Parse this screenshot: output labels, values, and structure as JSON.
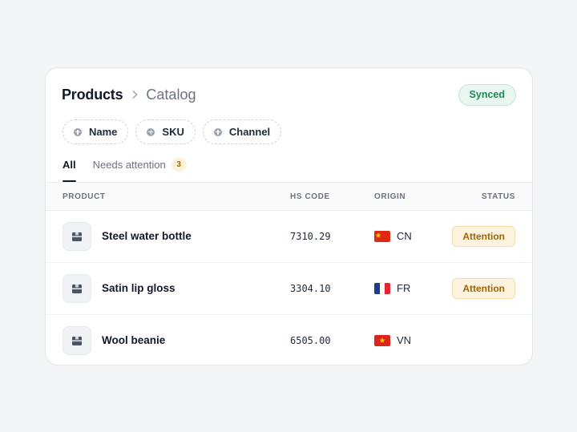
{
  "header": {
    "breadcrumb_main": "Products",
    "breadcrumb_sub": "Catalog",
    "sync_status": "Synced"
  },
  "filters": [
    {
      "label": "Name",
      "icon": "plus-circle-icon"
    },
    {
      "label": "SKU",
      "icon": "plus-circle-icon"
    },
    {
      "label": "Channel",
      "icon": "plus-circle-icon"
    }
  ],
  "tabs": [
    {
      "label": "All",
      "active": true
    },
    {
      "label": "Needs attention",
      "count": "3",
      "active": false
    }
  ],
  "table": {
    "columns": {
      "product": "PRODUCT",
      "hs_code": "HS CODE",
      "origin": "ORIGIN",
      "status": "STATUS"
    },
    "rows": [
      {
        "name": "Steel water bottle",
        "hs_code": "7310.29",
        "origin": "CN",
        "flag": "china-flag-icon",
        "status": "Attention"
      },
      {
        "name": "Satin lip gloss",
        "hs_code": "3304.10",
        "origin": "FR",
        "flag": "france-flag-icon",
        "status": "Attention"
      },
      {
        "name": "Wool beanie",
        "hs_code": "6505.00",
        "origin": "VN",
        "flag": "vietnam-flag-icon",
        "status": ""
      }
    ]
  },
  "colors": {
    "synced_green": "#1e8a55",
    "attention_amber": "#a16207",
    "accent_dark": "#111827"
  }
}
